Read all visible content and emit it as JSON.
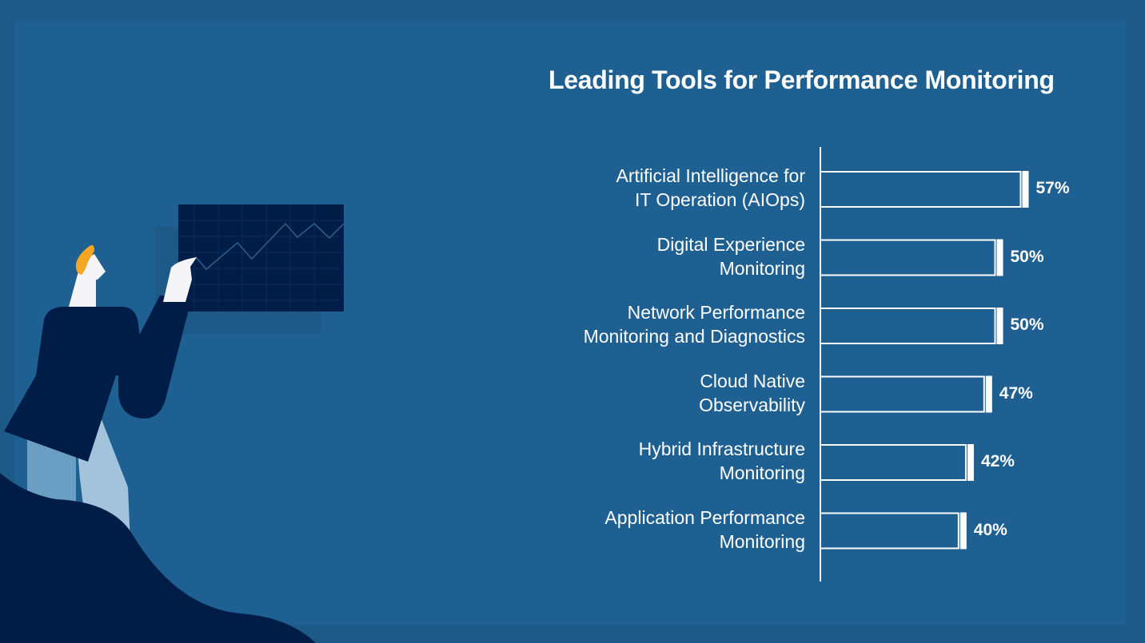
{
  "colors": {
    "background": "#1f6092",
    "frame": "#1d5a88",
    "navy": "#001d47",
    "bar_outline": "#ffffff",
    "hair": "#f5a623",
    "skin": "#f5f5f7",
    "pants_light": "#a3c3dc",
    "pants_mid": "#6a9fc3"
  },
  "illustration": {
    "description": "person pointing at rising line chart on a dark board"
  },
  "chart_data": {
    "type": "bar",
    "orientation": "horizontal",
    "title": "Leading Tools for Performance Monitoring",
    "xlabel": "",
    "ylabel": "",
    "xlim": [
      0,
      60
    ],
    "grid": false,
    "legend": "none",
    "categories": [
      "Artificial Intelligence for\nIT Operation (AIOps)",
      "Digital Experience\nMonitoring",
      "Network Performance\nMonitoring and Diagnostics",
      "Cloud Native\nObservability",
      "Hybrid Infrastructure\nMonitoring",
      "Application Performance\nMonitoring"
    ],
    "values": [
      57,
      50,
      50,
      47,
      42,
      40
    ],
    "value_labels": [
      "57%",
      "50%",
      "50%",
      "47%",
      "42%",
      "40%"
    ],
    "unit": "%"
  }
}
